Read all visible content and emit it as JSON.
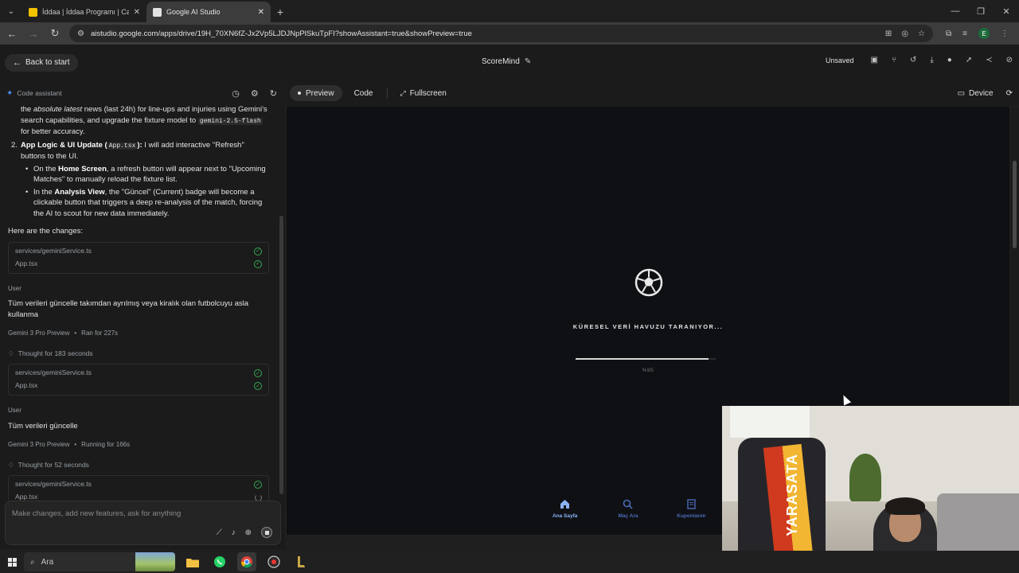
{
  "browser": {
    "tabs": [
      {
        "title": "İddaa | İddaa Programı | Canlı İddaa",
        "active": false,
        "favicon_color": "#f2c200"
      },
      {
        "title": "Google AI Studio",
        "active": true,
        "favicon_color": "#e3e3e3"
      }
    ],
    "url": "aistudio.google.com/apps/drive/19H_70XN6fZ-Jx2Vp5LJDJNpPlSkuTpFI?showAssistant=true&showPreview=true"
  },
  "app_header": {
    "back_label": "Back to start",
    "title": "ScoreMind",
    "status": "Unsaved"
  },
  "assistant": {
    "header_label": "Code assistant",
    "intro_part1": "the ",
    "intro_em": "absolute latest",
    "intro_part2": " news (last 24h) for line-ups and injuries using Gemini's search capabilities, and upgrade the fixture model to ",
    "intro_code": "gemini-2.5-flash",
    "intro_part3": " for better accuracy.",
    "item2_num": "2.",
    "item2_bold": "App Logic & UI Update (",
    "item2_code": "App.tsx",
    "item2_bold_end": "):",
    "item2_text": " I will add interactive \"Refresh\" buttons to the UI.",
    "bullet1_pre": "On the ",
    "bullet1_bold": "Home Screen",
    "bullet1_post": ", a refresh button will appear next to \"Upcoming Matches\" to manually reload the fixture list.",
    "bullet2_pre": "In the ",
    "bullet2_bold": "Analysis View",
    "bullet2_post": ", the \"Güncel\" (Current) badge will become a clickable button that triggers a deep re-analysis of the match, forcing the AI to scout for new data immediately.",
    "changes_label": "Here are the changes:",
    "files1": [
      "services/geminiService.ts",
      "App.tsx"
    ],
    "user_label": "User",
    "msg1": "Tüm verileri güncelle takımdan ayrılmış veya kiralık olan futbolcuyu asla kullanma",
    "model1": "Gemini 3 Pro Preview",
    "run1": "Ran for 227s",
    "thought1": "Thought for 183 seconds",
    "files2": [
      "services/geminiService.ts",
      "App.tsx"
    ],
    "msg2": "Tüm verileri güncelle",
    "model2": "Gemini 3 Pro Preview",
    "run2": "Running for 166s",
    "thought2": "Thought for 52 seconds",
    "files3": [
      "services/geminiService.ts",
      "App.tsx"
    ],
    "input_placeholder": "Make changes, add new features, ask for anything"
  },
  "preview_toolbar": {
    "preview_label": "Preview",
    "code_label": "Code",
    "fullscreen_label": "Fullscreen",
    "device_label": "Device"
  },
  "preview": {
    "loading_text": "KÜRESEL VERİ HAVUZU TARANIYOR...",
    "progress_percent": 95,
    "progress_label": "%95",
    "nav": [
      {
        "label": "Ana Sayfa",
        "active": true
      },
      {
        "label": "Maç Ara",
        "active": false
      },
      {
        "label": "Kuponlarım",
        "active": false
      }
    ]
  },
  "taskbar": {
    "search_label": "Ara"
  },
  "webcam": {
    "scarf_text": "YARASATA"
  }
}
